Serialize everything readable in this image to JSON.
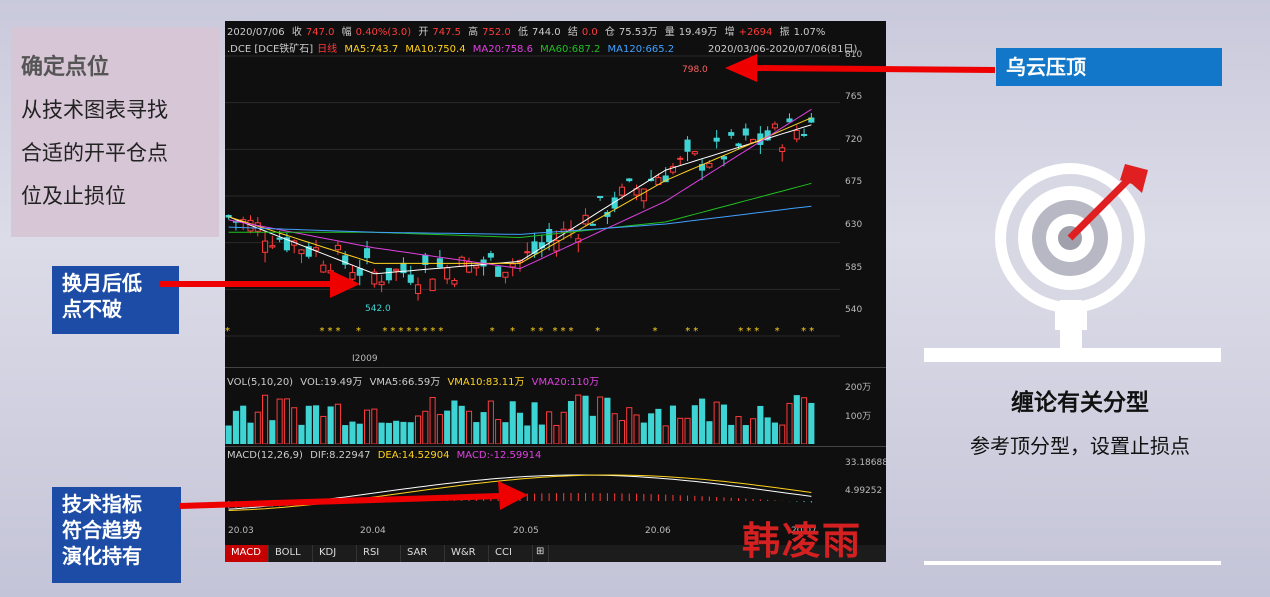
{
  "left_box": {
    "title": "确定点位",
    "lines": [
      "从技术图表寻找",
      "合适的开平仓点",
      "位及止损位"
    ]
  },
  "tags": {
    "month_line1": "换月后低",
    "month_line2": "点不破",
    "tech_line1": "技术指标",
    "tech_line2": "符合趋势",
    "tech_line3": "演化持有",
    "cloud": "乌云压顶"
  },
  "right": {
    "title": "缠论有关分型",
    "text": "参考顶分型，设置止损点"
  },
  "watermark": "韩凌雨",
  "chart": {
    "header": {
      "date": "2020/07/06",
      "close_label": "收",
      "close": "747.0",
      "chg_label": "幅",
      "chg": "0.40%(3.0)",
      "open_label": "开",
      "open": "747.5",
      "high_label": "高",
      "high": "752.0",
      "low_label": "低",
      "low": "744.0",
      "settle_label": "结",
      "settle": "0.0",
      "oi_label": "仓",
      "oi": "75.53万",
      "vol_label": "量",
      "vol": "19.49万",
      "add_label": "增",
      "add": "+2694",
      "amp_label": "振",
      "amp": "1.07%"
    },
    "ma_line": {
      "symbol": ".DCE [DCE铁矿石]",
      "tag": "日线",
      "ma5": "MA5:743.7",
      "ma10": "MA10:750.4",
      "ma20": "MA20:758.6",
      "ma60": "MA60:687.2",
      "ma120": "MA120:665.2",
      "range": "2020/03/06-2020/07/06(81日)"
    },
    "price_ticks": [
      "810",
      "765",
      "720",
      "675",
      "630",
      "585",
      "540"
    ],
    "high_mark": "798.0",
    "low_mark": "542.0",
    "contract": "I2009",
    "vol_line": {
      "label": "VOL(5,10,20)",
      "vol": "VOL:19.49万",
      "vma5": "VMA5:66.59万",
      "vma10": "VMA10:83.11万",
      "vma20": "VMA20:110万"
    },
    "vol_ticks": [
      "200万",
      "100万"
    ],
    "macd_line": {
      "label": "MACD(12,26,9)",
      "dif": "DIF:8.22947",
      "dea": "DEA:14.52904",
      "macd": "MACD:-12.59914"
    },
    "macd_ticks": [
      "33.18688",
      "4.99252"
    ],
    "date_ticks": [
      "20.03",
      "20.04",
      "20.05",
      "20.06",
      "20.07"
    ],
    "tabs": [
      "MACD",
      "BOLL",
      "KDJ",
      "RSI",
      "SAR",
      "W&R",
      "CCI",
      "⊞"
    ]
  },
  "chart_data": {
    "type": "line",
    "title": "",
    "x": [
      "20.03",
      "20.04",
      "20.05",
      "20.06",
      "20.07"
    ],
    "ylim": [
      540,
      810
    ],
    "series": [
      {
        "name": "MA5",
        "values": [
          655,
          600,
          612,
          700,
          743.7
        ]
      },
      {
        "name": "MA10",
        "values": [
          655,
          610,
          610,
          690,
          750.4
        ]
      },
      {
        "name": "MA20",
        "values": [
          652,
          625,
          605,
          670,
          758.6
        ]
      },
      {
        "name": "MA60",
        "values": [
          640,
          640,
          635,
          650,
          687.2
        ]
      },
      {
        "name": "MA120",
        "values": [
          645,
          640,
          638,
          648,
          665.2
        ]
      }
    ],
    "colors": {
      "up": "#ff3b3b",
      "down": "#3fd4d4",
      "ma5": "#ffffff",
      "ma10": "#ffd21e",
      "ma20": "#e040e0",
      "ma60": "#20c020",
      "ma120": "#40a0ff"
    }
  }
}
